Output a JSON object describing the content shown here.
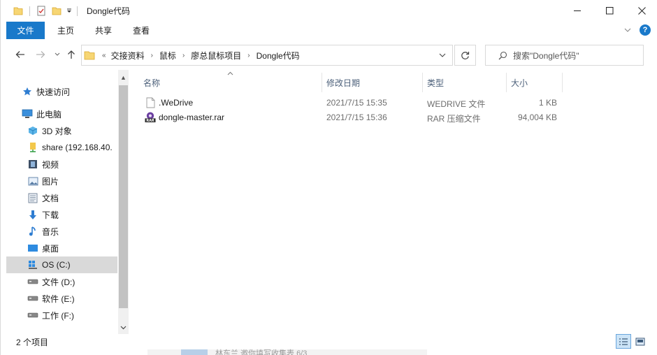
{
  "window": {
    "title": "Dongle代码",
    "controls": {
      "minimize": "minimize-icon",
      "maximize": "maximize-icon",
      "close": "close-icon"
    }
  },
  "ribbon": {
    "tabs": [
      {
        "label": "文件",
        "active": true
      },
      {
        "label": "主页"
      },
      {
        "label": "共享"
      },
      {
        "label": "查看"
      }
    ],
    "accent": "#1979ca"
  },
  "address": {
    "overflow": "«",
    "crumbs": [
      "交接资料",
      "鼠标",
      "廖总鼠标项目",
      "Dongle代码"
    ]
  },
  "search": {
    "placeholder": "搜索\"Dongle代码\""
  },
  "nav": {
    "items": [
      {
        "label": "快速访问",
        "icon": "star-icon"
      },
      {
        "label": "此电脑",
        "icon": "computer-icon"
      },
      {
        "label": "3D 对象",
        "icon": "cube-icon"
      },
      {
        "label": "share (192.168.40.",
        "icon": "network-drive-icon"
      },
      {
        "label": "视频",
        "icon": "video-icon"
      },
      {
        "label": "图片",
        "icon": "picture-icon"
      },
      {
        "label": "文档",
        "icon": "document-icon"
      },
      {
        "label": "下载",
        "icon": "download-icon"
      },
      {
        "label": "音乐",
        "icon": "music-icon"
      },
      {
        "label": "桌面",
        "icon": "desktop-icon"
      },
      {
        "label": "OS (C:)",
        "icon": "os-drive-icon",
        "selected": true
      },
      {
        "label": "文件 (D:)",
        "icon": "drive-icon"
      },
      {
        "label": "软件 (E:)",
        "icon": "drive-icon"
      },
      {
        "label": "工作 (F:)",
        "icon": "drive-icon"
      }
    ]
  },
  "files": {
    "columns": [
      "名称",
      "修改日期",
      "类型",
      "大小"
    ],
    "rows": [
      {
        "name": ".WeDrive",
        "date": "2021/7/15 15:35",
        "type": "WEDRIVE 文件",
        "size": "1 KB",
        "icon": "blank-file-icon"
      },
      {
        "name": "dongle-master.rar",
        "date": "2021/7/15 15:36",
        "type": "RAR 压缩文件",
        "size": "94,004 KB",
        "icon": "rar-archive-icon"
      }
    ]
  },
  "status": {
    "count": "2 个项目"
  },
  "peek": {
    "text": "林东兰 邀你填写收集表 6/3"
  }
}
